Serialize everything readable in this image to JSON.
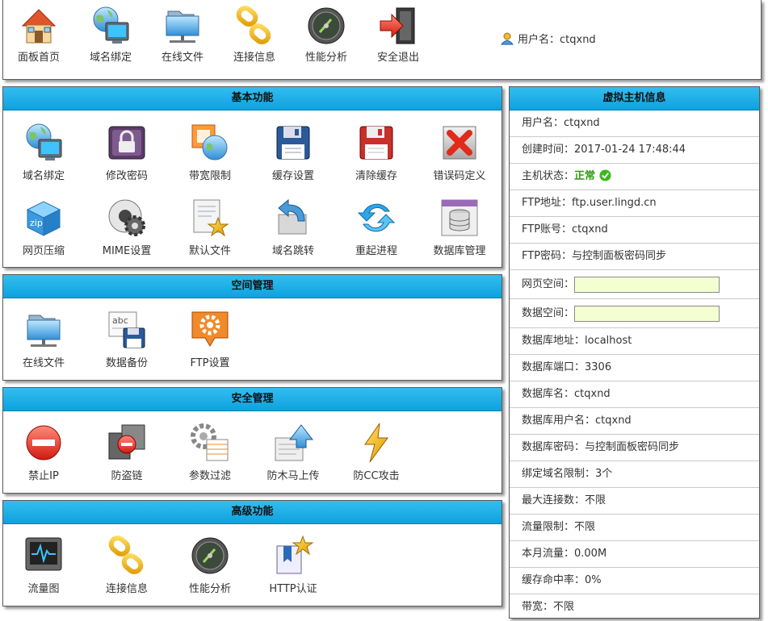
{
  "topnav": {
    "items": [
      {
        "label": "面板首页",
        "icon": "home-icon"
      },
      {
        "label": "域名绑定",
        "icon": "globe-monitor-icon"
      },
      {
        "label": "在线文件",
        "icon": "network-folder-icon"
      },
      {
        "label": "连接信息",
        "icon": "chain-link-icon"
      },
      {
        "label": "性能分析",
        "icon": "gauge-icon"
      },
      {
        "label": "安全退出",
        "icon": "exit-door-icon"
      }
    ],
    "user_label": "用户名：ctqxnd"
  },
  "basic": {
    "title": "基本功能",
    "items": [
      {
        "label": "域名绑定",
        "icon": "globe-monitor-icon"
      },
      {
        "label": "修改密码",
        "icon": "lock-icon"
      },
      {
        "label": "带宽限制",
        "icon": "bandwidth-globe-icon"
      },
      {
        "label": "缓存设置",
        "icon": "floppy-disk-icon"
      },
      {
        "label": "清除缓存",
        "icon": "floppy-disk-red-icon"
      },
      {
        "label": "错误码定义",
        "icon": "red-x-icon"
      },
      {
        "label": "网页压缩",
        "icon": "zip-box-icon"
      },
      {
        "label": "MIME设置",
        "icon": "gear-disc-icon"
      },
      {
        "label": "默认文件",
        "icon": "document-star-icon"
      },
      {
        "label": "域名跳转",
        "icon": "redirect-arrow-icon"
      },
      {
        "label": "重起进程",
        "icon": "refresh-icon"
      },
      {
        "label": "数据库管理",
        "icon": "database-window-icon"
      }
    ]
  },
  "space": {
    "title": "空间管理",
    "items": [
      {
        "label": "在线文件",
        "icon": "network-folder-icon"
      },
      {
        "label": "数据备份",
        "icon": "backup-disk-icon"
      },
      {
        "label": "FTP设置",
        "icon": "ftp-gear-icon"
      }
    ]
  },
  "security": {
    "title": "安全管理",
    "items": [
      {
        "label": "禁止IP",
        "icon": "no-entry-icon"
      },
      {
        "label": "防盗链",
        "icon": "anti-leech-icon"
      },
      {
        "label": "参数过滤",
        "icon": "filter-gear-icon"
      },
      {
        "label": "防木马上传",
        "icon": "upload-triangle-icon"
      },
      {
        "label": "防CC攻击",
        "icon": "lightning-icon"
      }
    ]
  },
  "advanced": {
    "title": "高级功能",
    "items": [
      {
        "label": "流量图",
        "icon": "monitor-wave-icon"
      },
      {
        "label": "连接信息",
        "icon": "chain-link-icon"
      },
      {
        "label": "性能分析",
        "icon": "gauge-icon"
      },
      {
        "label": "HTTP认证",
        "icon": "bookmark-star-icon"
      }
    ]
  },
  "info": {
    "title": "虚拟主机信息",
    "rows": {
      "username": "用户名：ctqxnd",
      "created": "创建时间：2017-01-24 17:48:44",
      "status_label": "主机状态：",
      "status_value": "正常",
      "ftp_addr": "FTP地址：ftp.user.lingd.cn",
      "ftp_user": "FTP账号：ctqxnd",
      "ftp_pass": "FTP密码：与控制面板密码同步",
      "web_space": "网页空间：",
      "db_space": "数据空间：",
      "db_addr": "数据库地址：localhost",
      "db_port": "数据库端口：3306",
      "db_name": "数据库名：ctqxnd",
      "db_user": "数据库用户名：ctqxnd",
      "db_pass": "数据库密码：与控制面板密码同步",
      "domain_limit": "绑定域名限制：3个",
      "max_conn": "最大连接数：不限",
      "traffic_limit": "流量限制：不限",
      "month_traffic": "本月流量：0.00M",
      "cache_hit": "缓存命中率：0%",
      "bandwidth": "带宽：不限"
    }
  },
  "colors": {
    "header_blue": "#1aaee6",
    "status_green": "#2e9a10",
    "usage_bar": "#f4ffd1"
  }
}
